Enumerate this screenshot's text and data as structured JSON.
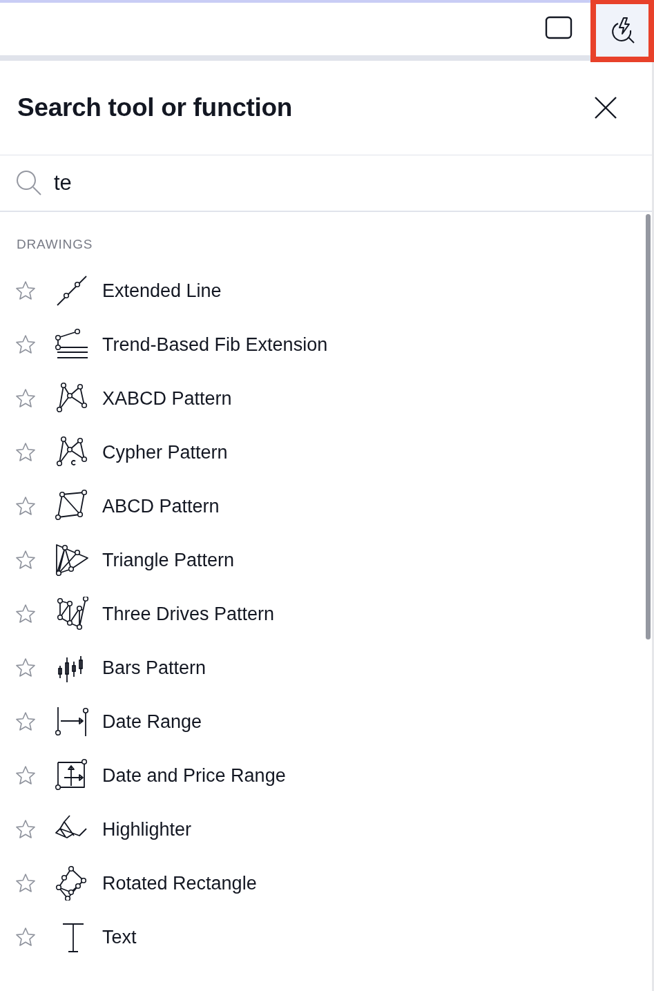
{
  "toolbar": {
    "buttons": [
      {
        "kind": "layout",
        "selected": false
      },
      {
        "kind": "quick-search",
        "selected": true
      }
    ]
  },
  "panel": {
    "title": "Search tool or function",
    "search": {
      "value": "te"
    },
    "section": "DRAWINGS",
    "items": [
      {
        "label": "Extended Line",
        "kind": "extended-line",
        "starred": false
      },
      {
        "label": "Trend-Based Fib Extension",
        "kind": "fib-extension",
        "starred": false
      },
      {
        "label": "XABCD Pattern",
        "kind": "xabcd",
        "starred": false
      },
      {
        "label": "Cypher Pattern",
        "kind": "cypher",
        "starred": false
      },
      {
        "label": "ABCD Pattern",
        "kind": "abcd",
        "starred": false
      },
      {
        "label": "Triangle Pattern",
        "kind": "triangle",
        "starred": false
      },
      {
        "label": "Three Drives Pattern",
        "kind": "three-drives",
        "starred": false
      },
      {
        "label": "Bars Pattern",
        "kind": "bars",
        "starred": false
      },
      {
        "label": "Date Range",
        "kind": "date-range",
        "starred": false
      },
      {
        "label": "Date and Price Range",
        "kind": "date-price-range",
        "starred": false
      },
      {
        "label": "Highlighter",
        "kind": "highlighter",
        "starred": false
      },
      {
        "label": "Rotated Rectangle",
        "kind": "rotated-rectangle",
        "starred": false
      },
      {
        "label": "Text",
        "kind": "text",
        "starred": false
      }
    ]
  }
}
